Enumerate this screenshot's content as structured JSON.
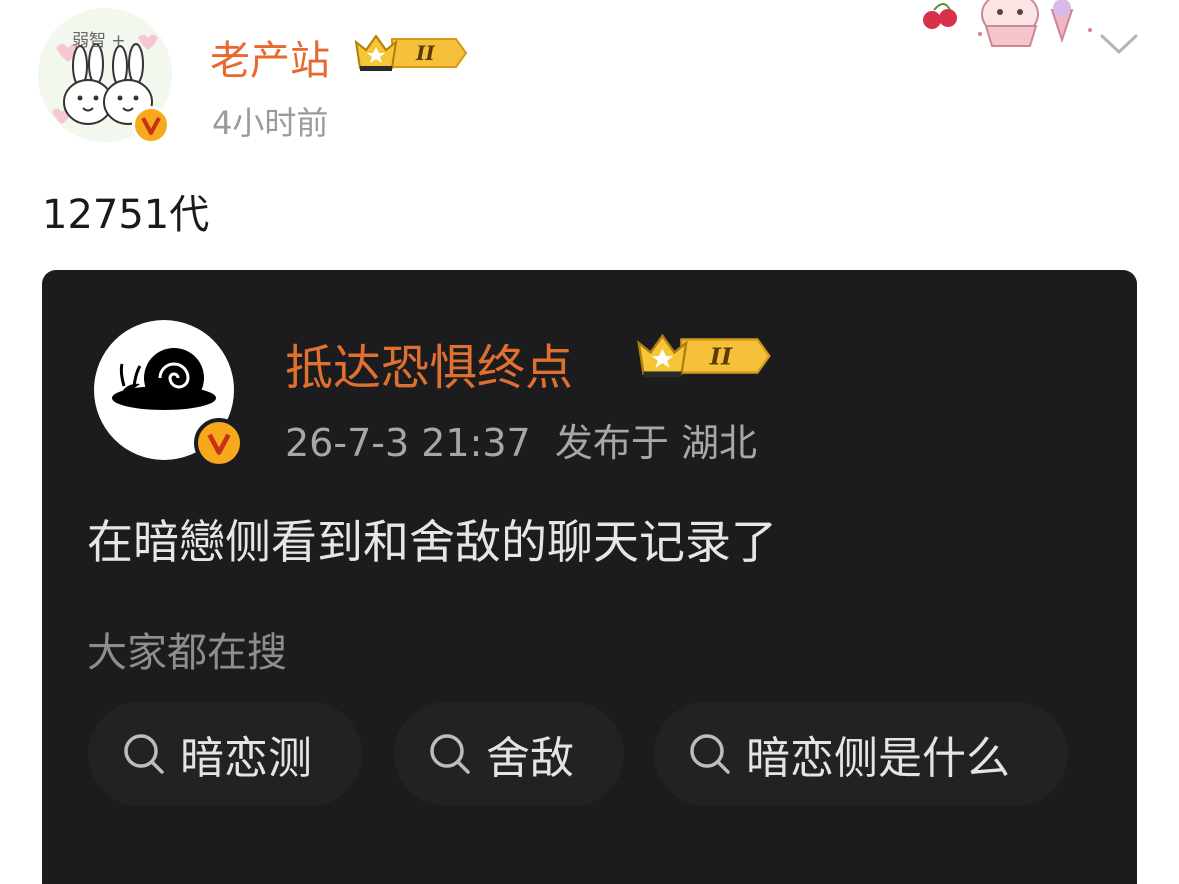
{
  "header": {
    "avatar_caption": "弱智 +",
    "username": "老产站",
    "level_badge": "II",
    "post_time": "4小时前",
    "accent_color": "#e8692f"
  },
  "post": {
    "text": "12751代"
  },
  "quoted_card": {
    "username": "抵达恐惧终点",
    "level_badge": "II",
    "date": "26-7-3 21:37",
    "location": "发布于 湖北",
    "body": "在暗戀侧看到和舍敌的聊天记录了",
    "search_heading": "大家都在搜",
    "searches": [
      {
        "label": "暗恋测",
        "icon": "search-icon"
      },
      {
        "label": "舍敌",
        "icon": "search-icon"
      },
      {
        "label": "暗恋侧是什么",
        "icon": "search-icon"
      }
    ],
    "background_color": "#1c1c1e",
    "name_color": "#e0702f"
  },
  "icons": {
    "verified": "verified-v-icon",
    "crown": "crown-icon",
    "more": "chevron-down-icon"
  }
}
